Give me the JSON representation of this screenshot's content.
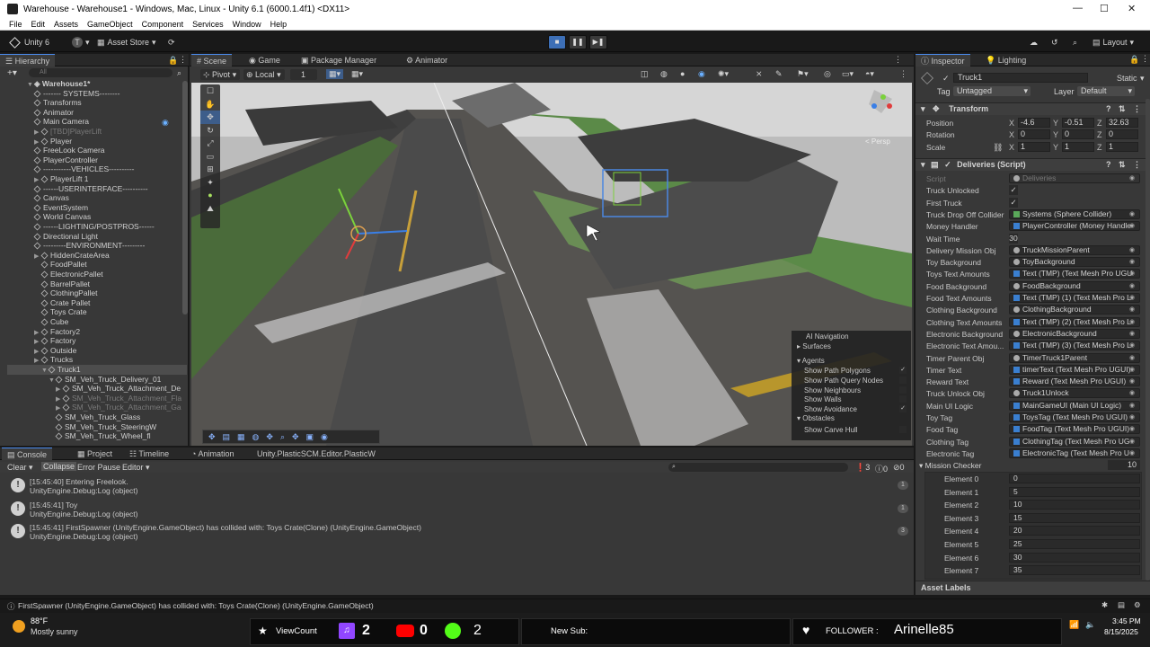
{
  "window": {
    "title": "Warehouse - Warehouse1 - Windows, Mac, Linux - Unity 6.1 (6000.1.4f1) <DX11>"
  },
  "menu": [
    "File",
    "Edit",
    "Assets",
    "GameObject",
    "Component",
    "Services",
    "Window",
    "Help"
  ],
  "toolbar": {
    "account": "Unity 6",
    "account_initial": "T",
    "asset_store": "Asset Store",
    "layout": "Layout"
  },
  "hierarchy": {
    "tab": "Hierarchy",
    "search_placeholder": "All",
    "scene": "Warehouse1*",
    "items": [
      {
        "label": "------- SYSTEMS--------",
        "dim": false
      },
      {
        "label": "Transforms",
        "dim": false
      },
      {
        "label": "Animator",
        "dim": false
      },
      {
        "label": "Main Camera",
        "dim": false
      },
      {
        "label": "[TBD]PlayerLift",
        "dim": true
      },
      {
        "label": "Player",
        "dim": false
      },
      {
        "label": "FreeLook Camera",
        "dim": false
      },
      {
        "label": "PlayerController",
        "dim": false
      },
      {
        "label": "-----------VEHICLES----------",
        "dim": false
      },
      {
        "label": "PlayerLift 1",
        "dim": false
      },
      {
        "label": "------USERINTERFACE----------",
        "dim": false
      },
      {
        "label": "Canvas",
        "dim": false
      },
      {
        "label": "EventSystem",
        "dim": false
      },
      {
        "label": "World Canvas",
        "dim": false
      },
      {
        "label": "------LIGHTING/POSTPROS------",
        "dim": false
      },
      {
        "label": "Directional Light",
        "dim": false
      },
      {
        "label": "---------ENVIRONMENT---------",
        "dim": false
      },
      {
        "label": "HiddenCrateArea",
        "dim": false
      },
      {
        "label": "FoodPallet",
        "dim": false
      },
      {
        "label": "ElectronicPallet",
        "dim": false
      },
      {
        "label": "BarrelPallet",
        "dim": false
      },
      {
        "label": "ClothingPallet",
        "dim": false
      },
      {
        "label": "Crate Pallet",
        "dim": false
      },
      {
        "label": "Toys Crate",
        "dim": false
      },
      {
        "label": "Cube",
        "dim": false
      },
      {
        "label": "Factory2",
        "dim": false
      },
      {
        "label": "Factory",
        "dim": false
      },
      {
        "label": "Outside",
        "dim": false
      },
      {
        "label": "Trucks",
        "dim": false
      },
      {
        "label": "Truck1",
        "dim": false
      },
      {
        "label": "SM_Veh_Truck_Delivery_01",
        "dim": false
      },
      {
        "label": "SM_Veh_Truck_Attachment_De",
        "dim": false
      },
      {
        "label": "SM_Veh_Truck_Attachment_Fla",
        "dim": true
      },
      {
        "label": "SM_Veh_Truck_Attachment_Ga",
        "dim": true
      },
      {
        "label": "SM_Veh_Truck_Glass",
        "dim": false
      },
      {
        "label": "SM_Veh_Truck_SteeringW",
        "dim": false
      },
      {
        "label": "SM_Veh_Truck_Wheel_fl",
        "dim": false
      }
    ]
  },
  "center_tabs": [
    "Scene",
    "Game",
    "Package Manager",
    "Animator"
  ],
  "scene_toolbar": {
    "pivot": "Pivot",
    "local": "Local",
    "snap": "1"
  },
  "scene_overlay": {
    "header": "AI Navigation",
    "surfaces": "Surfaces",
    "agents": "Agents",
    "agent_options": [
      {
        "label": "Show Path Polygons",
        "checked": true
      },
      {
        "label": "Show Path Query Nodes",
        "checked": false
      },
      {
        "label": "Show Neighbours",
        "checked": false
      },
      {
        "label": "Show Walls",
        "checked": false
      },
      {
        "label": "Show Avoidance",
        "checked": true
      }
    ],
    "obstacles": "Obstacles",
    "obstacle_options": [
      {
        "label": "Show Carve Hull",
        "checked": false
      }
    ],
    "persp": "< Persp"
  },
  "inspector": {
    "tabs": [
      "Inspector",
      "Lighting"
    ],
    "object_name": "Truck1",
    "static": "Static",
    "tag_label": "Tag",
    "tag": "Untagged",
    "layer_label": "Layer",
    "layer": "Default",
    "transform": {
      "header": "Transform",
      "rows": [
        {
          "label": "Position",
          "x": "-4.6",
          "y": "-0.51",
          "z": "32.63"
        },
        {
          "label": "Rotation",
          "x": "0",
          "y": "0",
          "z": "0"
        },
        {
          "label": "Scale",
          "x": "1",
          "y": "1",
          "z": "1"
        }
      ]
    },
    "deliveries": {
      "header": "Deliveries (Script)",
      "fields": [
        {
          "label": "Script",
          "value": "Deliveries",
          "icon": "script",
          "dim": true
        },
        {
          "label": "Truck Unlocked",
          "value": "✓",
          "icon": "none"
        },
        {
          "label": "First Truck",
          "value": "✓",
          "icon": "none"
        },
        {
          "label": "Truck Drop Off Collider",
          "value": "Systems (Sphere Collider)",
          "icon": "green"
        },
        {
          "label": "Money Handler",
          "value": "PlayerController (Money Handle",
          "icon": "blue"
        },
        {
          "label": "Wait Time",
          "value": "30",
          "icon": "none"
        },
        {
          "label": "Delivery Mission Obj",
          "value": "TruckMissionParent",
          "icon": "obj"
        },
        {
          "label": "Toy Background",
          "value": "ToyBackground",
          "icon": "obj"
        },
        {
          "label": "Toys Text Amounts",
          "value": "Text (TMP) (Text Mesh Pro UGU",
          "icon": "blue"
        },
        {
          "label": "Food Background",
          "value": "FoodBackground",
          "icon": "obj"
        },
        {
          "label": "Food Text Amounts",
          "value": "Text (TMP) (1) (Text Mesh Pro L",
          "icon": "blue"
        },
        {
          "label": "Clothing Background",
          "value": "ClothingBackground",
          "icon": "obj"
        },
        {
          "label": "Clothing Text Amounts",
          "value": "Text (TMP) (2) (Text Mesh Pro L",
          "icon": "blue"
        },
        {
          "label": "Electronic Background",
          "value": "ElectronicBackground",
          "icon": "obj"
        },
        {
          "label": "Electronic Text Amou...",
          "value": "Text (TMP) (3) (Text Mesh Pro L",
          "icon": "blue"
        },
        {
          "label": "Timer Parent Obj",
          "value": "TimerTruck1Parent",
          "icon": "obj"
        },
        {
          "label": "Timer Text",
          "value": "timerText (Text Mesh Pro UGUI)",
          "icon": "blue"
        },
        {
          "label": "Reward Text",
          "value": "Reward (Text Mesh Pro UGUI)",
          "icon": "blue"
        },
        {
          "label": "Truck Unlock Obj",
          "value": "Truck1Unlock",
          "icon": "obj"
        },
        {
          "label": "Main UI Logic",
          "value": "MainGameUI (Main UI Logic)",
          "icon": "blue"
        },
        {
          "label": "Toy Tag",
          "value": "ToysTag (Text Mesh Pro UGUI)",
          "icon": "blue"
        },
        {
          "label": "Food Tag",
          "value": "FoodTag (Text Mesh Pro UGUI)",
          "icon": "blue"
        },
        {
          "label": "Clothing Tag",
          "value": "ClothingTag (Text Mesh Pro UG",
          "icon": "blue"
        },
        {
          "label": "Electronic Tag",
          "value": "ElectronicTag (Text Mesh Pro U",
          "icon": "blue"
        }
      ],
      "mission_checker": {
        "label": "Mission Checker",
        "count": "10"
      },
      "elements": [
        {
          "label": "Element 0",
          "value": "0"
        },
        {
          "label": "Element 1",
          "value": "5"
        },
        {
          "label": "Element 2",
          "value": "10"
        },
        {
          "label": "Element 3",
          "value": "15"
        },
        {
          "label": "Element 4",
          "value": "20"
        },
        {
          "label": "Element 5",
          "value": "25"
        },
        {
          "label": "Element 6",
          "value": "30"
        },
        {
          "label": "Element 7",
          "value": "35"
        }
      ]
    },
    "asset_labels": "Asset Labels"
  },
  "console": {
    "tabs": [
      "Console",
      "Project",
      "Timeline",
      "Animation",
      "Unity.PlasticSCM.Editor.PlasticW"
    ],
    "buttons": [
      "Clear",
      "Collapse",
      "Error Pause",
      "Editor"
    ],
    "counts": {
      "warn": "3",
      "info": "0",
      "error": "0"
    },
    "logs": [
      {
        "line1": "[15:45:40] Entering Freelook.",
        "line2": "UnityEngine.Debug:Log (object)",
        "count": "1"
      },
      {
        "line1": "[15:45:41] Toy",
        "line2": "UnityEngine.Debug:Log (object)",
        "count": "1"
      },
      {
        "line1": "[15:45:41] FirstSpawner (UnityEngine.GameObject) has collided with: Toys Crate(Clone) (UnityEngine.GameObject)",
        "line2": "UnityEngine.Debug:Log (object)",
        "count": "3"
      }
    ]
  },
  "statusbar": {
    "message": "FirstSpawner (UnityEngine.GameObject) has collided with: Toys Crate(Clone) (UnityEngine.GameObject)"
  },
  "taskbar": {
    "weather_temp": "88°F",
    "weather_desc": "Mostly sunny",
    "viewcount_label": "ViewCount",
    "twitch_count": "2",
    "youtube_count": "0",
    "kick_count": "2",
    "new_sub_label": "New Sub:",
    "follower_label": "FOLLOWER :",
    "follower_name": "Arinelle85",
    "time": "3:45 PM",
    "date": "8/15/2025"
  },
  "colors": {
    "accent": "#4a8cf0",
    "panel": "#383838",
    "dark": "#191919"
  }
}
